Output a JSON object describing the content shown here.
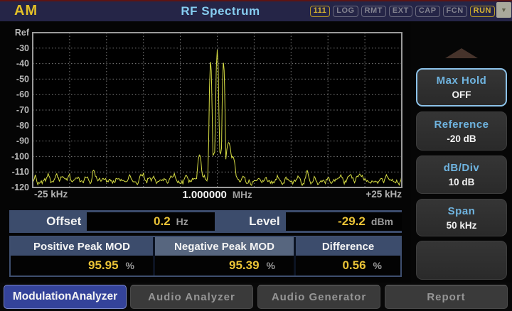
{
  "header": {
    "mode": "AM",
    "title": "RF Spectrum",
    "badges": [
      {
        "label": "111",
        "state": "on"
      },
      {
        "label": "LOG",
        "state": "idle"
      },
      {
        "label": "RMT",
        "state": "idle"
      },
      {
        "label": "EXT",
        "state": "idle"
      },
      {
        "label": "CAP",
        "state": "idle"
      },
      {
        "label": "FCN",
        "state": "idle"
      },
      {
        "label": "RUN",
        "state": "on"
      }
    ],
    "corner_chevron": "▼"
  },
  "chart_data": {
    "type": "line",
    "title": "RF Spectrum",
    "x_axis": {
      "left_label": "-25 kHz",
      "center_value": "1.000000",
      "center_unit": "MHz",
      "right_label": "+25 kHz",
      "span_khz": 50
    },
    "y_axis": {
      "top_label": "Ref",
      "ref_db": -20,
      "min_db": -120,
      "db_per_div": 10,
      "tick_labels": [
        "-30",
        "-40",
        "-50",
        "-60",
        "-70",
        "-80",
        "-90",
        "-100",
        "-110",
        "-120"
      ]
    },
    "grid": {
      "cols": 10,
      "rows": 10
    },
    "trace_color": "#d8de44",
    "noise_floor_db": -114,
    "noise_var_db": 6,
    "skirt": {
      "level_db": -96,
      "half_width_khz": 1.6
    },
    "peaks": [
      {
        "offset_khz": -2.4,
        "level_db": -99,
        "half_width_khz": 0.4,
        "sharpness": 18
      },
      {
        "offset_khz": -0.9,
        "level_db": -39,
        "half_width_khz": 0.28,
        "sharpness": 60
      },
      {
        "offset_khz": 0.0,
        "level_db": -31,
        "half_width_khz": 0.28,
        "sharpness": 60
      },
      {
        "offset_khz": 0.85,
        "level_db": -39.5,
        "half_width_khz": 0.28,
        "sharpness": 60
      },
      {
        "offset_khz": 1.55,
        "level_db": -91,
        "half_width_khz": 0.5,
        "sharpness": 18
      },
      {
        "offset_khz": 2.1,
        "level_db": -100,
        "half_width_khz": 0.5,
        "sharpness": 15
      }
    ]
  },
  "readouts": {
    "offset": {
      "label": "Offset",
      "value": "0.2",
      "unit": "Hz"
    },
    "level": {
      "label": "Level",
      "value": "-29.2",
      "unit": "dBm"
    }
  },
  "mod_table": {
    "columns": [
      {
        "header": "Positive Peak MOD",
        "value": "95.95",
        "unit": "%"
      },
      {
        "header": "Negative Peak MOD",
        "value": "95.39",
        "unit": "%"
      },
      {
        "header": "Difference",
        "value": "0.56",
        "unit": "%"
      }
    ]
  },
  "sidebar": {
    "buttons": [
      {
        "label": "Max Hold",
        "value": "OFF",
        "highlighted": true
      },
      {
        "label": "Reference",
        "value": "-20 dB",
        "highlighted": false
      },
      {
        "label": "dB/Div",
        "value": "10 dB",
        "highlighted": false
      },
      {
        "label": "Span",
        "value": "50 kHz",
        "highlighted": false
      },
      {
        "label": "",
        "value": "",
        "highlighted": false
      }
    ]
  },
  "tabs": [
    {
      "label": "ModulationAnalyzer",
      "active": true
    },
    {
      "label": "Audio Analyzer",
      "active": false
    },
    {
      "label": "Audio Generator",
      "active": false
    },
    {
      "label": "Report",
      "active": false
    }
  ],
  "colors": {
    "header_bg": "#252547",
    "accent_cyan": "#86cdf0",
    "accent_yellow": "#e9c236",
    "trace_yellow": "#d8de44",
    "panel_blue": "#3c4c6c",
    "active_tab_blue": "#34439a"
  }
}
